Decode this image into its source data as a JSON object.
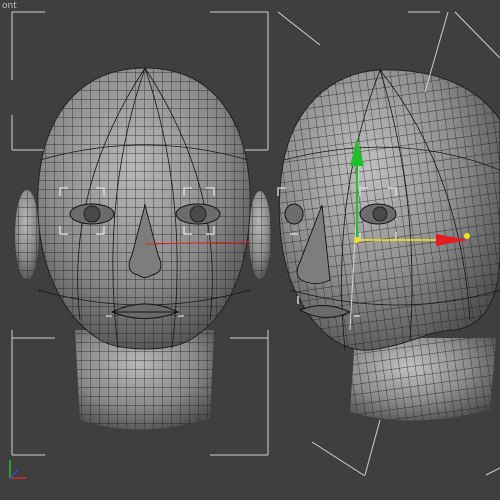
{
  "viewport": {
    "label": "ont",
    "background": "#3f3f3f",
    "wire_color": "#1a1a1a",
    "mesh_color": "#8e8e8e",
    "bracket_color": "#d8d8d8",
    "frame_color": "#d0d0d0"
  },
  "gizmo": {
    "x_axis_color": "#e02020",
    "y_axis_color": "#f4e21a",
    "z_axis_color": "#1fbf2a",
    "center_color": "#f4e21a"
  },
  "view_cube_axes": {
    "x_color": "#d03030",
    "y_color": "#30c030",
    "z_color": "#3050d0"
  },
  "objects": [
    {
      "name": "head-front"
    },
    {
      "name": "head-three-quarter"
    }
  ]
}
